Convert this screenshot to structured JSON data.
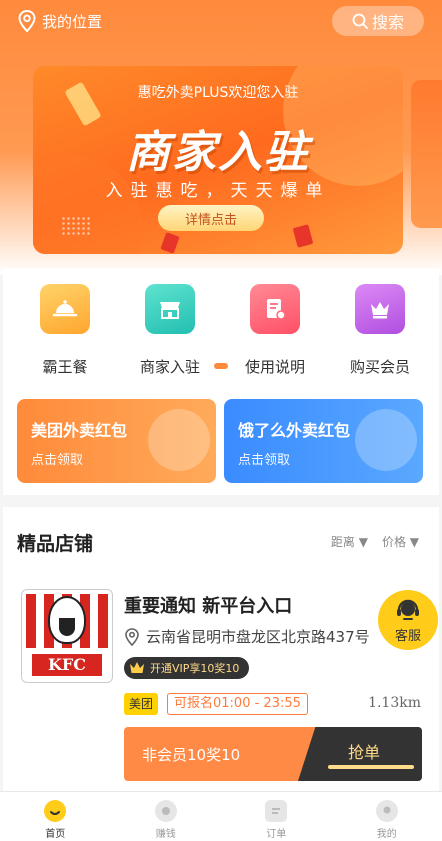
{
  "header": {
    "location_label": "我的位置",
    "search_label": "搜索"
  },
  "banner": {
    "subtitle": "惠吃外卖PLUS欢迎您入驻",
    "title": "商家入驻",
    "tagline": "入驻惠吃，天天爆单",
    "button_label": "详情点击"
  },
  "grid": [
    {
      "label": "霸王餐",
      "icon": "cloche-icon",
      "color": "#ffb84a"
    },
    {
      "label": "商家入驻",
      "icon": "store-icon",
      "color": "#3ccfc0"
    },
    {
      "label": "使用说明",
      "icon": "document-icon",
      "color": "#ff6a7a"
    },
    {
      "label": "购买会员",
      "icon": "crown-icon",
      "color": "#c06ae8"
    }
  ],
  "coupons": [
    {
      "title": "美团外卖红包",
      "subtitle": "点击领取"
    },
    {
      "title": "饿了么外卖红包",
      "subtitle": "点击领取"
    }
  ],
  "shops_section": {
    "title": "精品店铺",
    "sort_distance": "距离 ▼",
    "sort_price": "价格 ▼"
  },
  "shop": {
    "logo_text": "KFC",
    "name": "重要通知 新平台入口",
    "address": "云南省昆明市盘龙区北京路437号",
    "vip_label": "开通VIP享10奖10",
    "platform_tag": "美团",
    "time_tag": "可报名01:00 - 23:55",
    "distance": "1.13km",
    "reward_label": "非会员10奖10",
    "grab_label": "抢单"
  },
  "service": {
    "label": "客服"
  },
  "tabbar": [
    {
      "label": "首页",
      "icon": "home-icon",
      "active": true
    },
    {
      "label": "赚钱",
      "icon": "money-icon",
      "active": false
    },
    {
      "label": "订单",
      "icon": "order-icon",
      "active": false
    },
    {
      "label": "我的",
      "icon": "profile-icon",
      "active": false
    }
  ],
  "colors": {
    "accent": "#ff8a3c",
    "meituan": "#ffd100",
    "eleme": "#3a8bff",
    "dark": "#333333"
  }
}
